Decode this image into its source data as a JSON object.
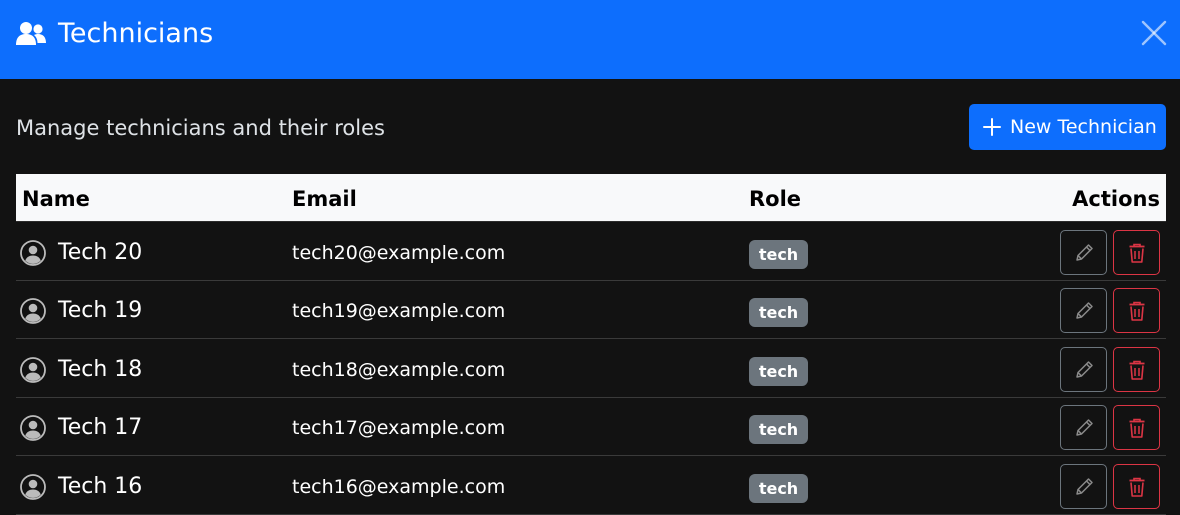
{
  "header": {
    "title": "Technicians",
    "icon": "people-icon",
    "close_icon": "close-icon"
  },
  "subtitle": "Manage technicians and their roles",
  "new_button": {
    "label": "New Technician",
    "icon": "plus-icon"
  },
  "table": {
    "columns": {
      "name": "Name",
      "email": "Email",
      "role": "Role",
      "actions": "Actions"
    },
    "rows": [
      {
        "name": "Tech 20",
        "email": "tech20@example.com",
        "role": "tech"
      },
      {
        "name": "Tech 19",
        "email": "tech19@example.com",
        "role": "tech"
      },
      {
        "name": "Tech 18",
        "email": "tech18@example.com",
        "role": "tech"
      },
      {
        "name": "Tech 17",
        "email": "tech17@example.com",
        "role": "tech"
      },
      {
        "name": "Tech 16",
        "email": "tech16@example.com",
        "role": "tech"
      }
    ]
  },
  "colors": {
    "primary": "#0d6efd",
    "background": "#121212",
    "badge": "#6c757d",
    "danger": "#dc3545"
  }
}
